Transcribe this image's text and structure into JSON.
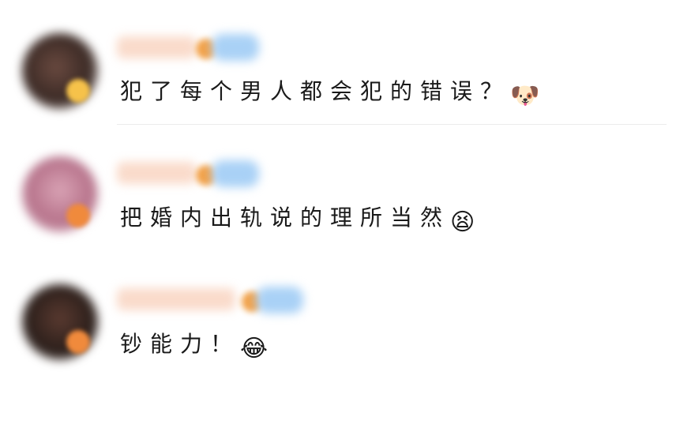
{
  "comments": [
    {
      "text": "犯了每个男人都会犯的错误？",
      "emoji": "🐶",
      "emoji_name": "doge-emoji",
      "avatar_color": "#3b2a25",
      "badge_color": "#f6c24a",
      "tag_color": "#9cc8f4"
    },
    {
      "text": "把婚内出轨说的理所当然",
      "emoji": "😫",
      "emoji_name": "tired-face-emoji",
      "avatar_color": "#b7738b",
      "badge_color": "#f08a3c",
      "tag_color": "#9cc8f4"
    },
    {
      "text": "钞能力！",
      "emoji": "😂",
      "emoji_name": "laughing-tears-emoji",
      "avatar_color": "#2a1e1a",
      "badge_color": "#f08a3c",
      "tag_color": "#9cc8f4"
    }
  ]
}
